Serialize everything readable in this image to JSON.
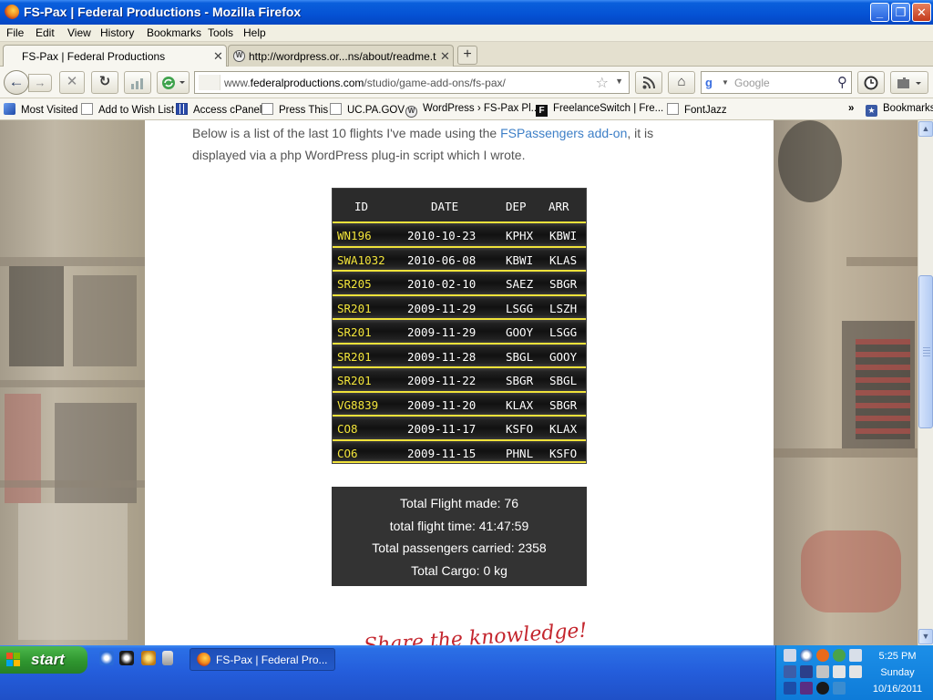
{
  "window": {
    "title": "FS-Pax | Federal Productions - Mozilla Firefox",
    "controls": [
      "_",
      "❐",
      "✕"
    ]
  },
  "menu": [
    "File",
    "Edit",
    "View",
    "History",
    "Bookmarks",
    "Tools",
    "Help"
  ],
  "tabs": [
    {
      "label": "FS-Pax | Federal Productions",
      "close": "✕"
    },
    {
      "label": "http://wordpress.or...ns/about/readme.txt",
      "close": "✕"
    }
  ],
  "new_tab": "+",
  "nav": {
    "back": "←",
    "forward": "→",
    "stop": "✕",
    "reload": "↻",
    "url_prefix": "www.",
    "url_domain": "federalproductions.com",
    "url_path": "/studio/game-add-ons/fs-pax/",
    "search_placeholder": "Google",
    "search_engine_icon": "google-icon",
    "home": "⌂",
    "rss": "rss-icon"
  },
  "bookmarks": [
    "Most Visited",
    "Add to Wish List",
    "Access cPanel",
    "Press This",
    "UC.PA.GOV",
    "WordPress › FS-Pax Pl...",
    "FreelanceSwitch | Fre...",
    "FontJazz"
  ],
  "bookmarks_overflow": "»",
  "bookmarks_menu": "Bookmarks",
  "page": {
    "intro_before": "Below is a list of the last 10 flights I've made using the ",
    "intro_link": "FSPassengers add-on",
    "intro_after": ", it is displayed via a php WordPress plug-in script which I wrote.",
    "columns": [
      "ID",
      "DATE",
      "DEP",
      "ARR"
    ],
    "flights": [
      {
        "id": "WN196",
        "date": "2010-10-23",
        "dep": "KPHX",
        "arr": "KBWI"
      },
      {
        "id": "SWA1032",
        "date": "2010-06-08",
        "dep": "KBWI",
        "arr": "KLAS"
      },
      {
        "id": "SR205",
        "date": "2010-02-10",
        "dep": "SAEZ",
        "arr": "SBGR"
      },
      {
        "id": "SR201",
        "date": "2009-11-29",
        "dep": "LSGG",
        "arr": "LSZH"
      },
      {
        "id": "SR201",
        "date": "2009-11-29",
        "dep": "GOOY",
        "arr": "LSGG"
      },
      {
        "id": "SR201",
        "date": "2009-11-28",
        "dep": "SBGL",
        "arr": "GOOY"
      },
      {
        "id": "SR201",
        "date": "2009-11-22",
        "dep": "SBGR",
        "arr": "SBGL"
      },
      {
        "id": "VG8839",
        "date": "2009-11-20",
        "dep": "KLAX",
        "arr": "SBGR"
      },
      {
        "id": "CO8",
        "date": "2009-11-17",
        "dep": "KSFO",
        "arr": "KLAX"
      },
      {
        "id": "CO6",
        "date": "2009-11-15",
        "dep": "PHNL",
        "arr": "KSFO"
      }
    ],
    "totals": [
      "Total Flight made: 76",
      "total flight time: 41:47:59",
      "Total passengers carried: 2358",
      "Total Cargo: 0 kg"
    ],
    "footer_handwriting": "Share the knowledge!"
  },
  "taskbar": {
    "start_label": "start",
    "task_label": "FS-Pax | Federal Pro...",
    "clock_time": "5:25 PM",
    "clock_day": "Sunday",
    "clock_date": "10/16/2011"
  },
  "colors": {
    "flight_id": "#f3e53b",
    "row_border": "#f0e23a",
    "link": "#3d7fc7",
    "title_bar": "#0552d4",
    "start_button": "#2f962f"
  }
}
